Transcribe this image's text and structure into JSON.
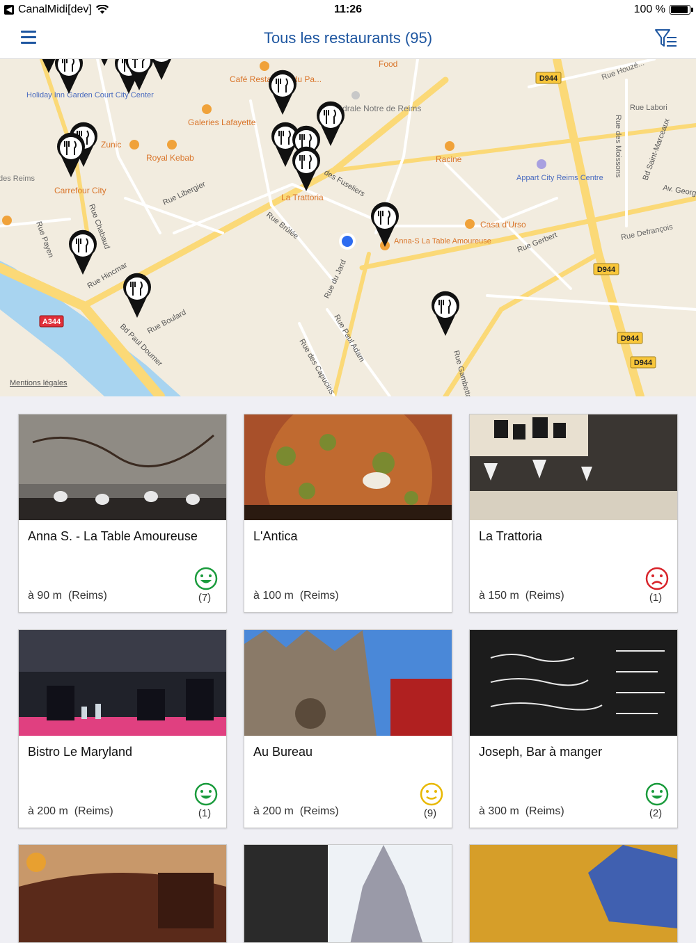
{
  "status_bar": {
    "app": "CanalMidi[dev]",
    "time": "11:26",
    "battery": "100 %",
    "battery_level": 1.0
  },
  "nav": {
    "title": "Tous les restaurants (95)",
    "menu_icon": "hamburger-icon",
    "filter_icon": "filter-icon"
  },
  "map": {
    "labels": {
      "cafe": "Café Restaurant du Pa...",
      "food": "Food",
      "d944": "D944",
      "rue_houzeau": "Rue Houzé...",
      "holiday": "Holiday Inn Garden Court City Center",
      "cathedrale": "Cathédrale Notre de Reims",
      "rue_labori": "Rue Labori",
      "galeries": "Galeries Lafayette",
      "zunic": "Zunic",
      "royal_kebab": "Royal Kebab",
      "racine": "Racine",
      "appart": "Appart City Reims Centre",
      "carrefour": "Carrefour City",
      "la_trattoria": "La Trattoria",
      "rue_libergier": "Rue Libergier",
      "fuseliers": "des Fuseliers",
      "casa": "Casa d'Urso",
      "anna": "Anna-S La Table Amoureuse",
      "rue_gerbert": "Rue Gerbert",
      "rue_defrancois": "Rue Defrançois",
      "av_georges": "Av. Georg...",
      "bd_saint": "Bd Saint-Marceaux",
      "rue_payen": "Rue Payen",
      "rue_chabaud": "Rue Chabaud",
      "rue_hincmar": "Rue Hincmar",
      "rue_brulee": "Rue Brûlée",
      "rue_du_jard": "Rue du Jard",
      "rue_paul_adam": "Rue Paul Adam",
      "rue_boulard": "Rue Boulard",
      "bd_paul_doumer": "Bd Paul Doumer",
      "rue_capucins": "Rue des Capucins",
      "rue_gambetta": "Rue Gambetta",
      "a344": "A344",
      "rue_moissons": "Rue des Moissons",
      "des_reims": "des Reims",
      "mentions": "Mentions légales"
    },
    "marker_icon": "restaurant-pin-icon",
    "location_icon": "current-location-icon"
  },
  "restaurants": [
    {
      "name": "Anna S. - La Table Amoureuse",
      "distance": "à 90 m",
      "city": "(Reims)",
      "rating": "happy",
      "count": "(7)",
      "color": "#1a9b3c"
    },
    {
      "name": "L'Antica",
      "distance": "à 100 m",
      "city": "(Reims)",
      "rating": "none",
      "count": "",
      "color": ""
    },
    {
      "name": "La Trattoria",
      "distance": "à 150 m",
      "city": "(Reims)",
      "rating": "sad",
      "count": "(1)",
      "color": "#d8232a"
    },
    {
      "name": "Bistro Le Maryland",
      "distance": "à 200 m",
      "city": "(Reims)",
      "rating": "happy",
      "count": "(1)",
      "color": "#1a9b3c"
    },
    {
      "name": "Au Bureau",
      "distance": "à 200 m",
      "city": "(Reims)",
      "rating": "neutral",
      "count": "(9)",
      "color": "#e8b800"
    },
    {
      "name": "Joseph, Bar à manger",
      "distance": "à 300 m",
      "city": "(Reims)",
      "rating": "happy",
      "count": "(2)",
      "color": "#1a9b3c"
    }
  ],
  "colors": {
    "accent": "#1e56a0",
    "map_bg": "#f2ecdf",
    "major_road": "#fbd977",
    "water": "#a8d4f0",
    "card_bg": "#ffffff"
  }
}
